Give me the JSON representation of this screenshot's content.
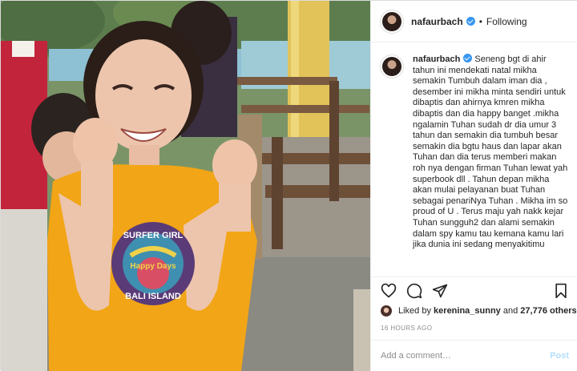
{
  "header": {
    "username": "nafaurbach",
    "separator": "•",
    "follow_status": "Following"
  },
  "caption": {
    "username": "nafaurbach",
    "text": "Seneng bgt di ahir tahun ini mendekati natal mikha semakin Tumbuh dalam iman dia , desember ini mikha minta sendiri untuk dibaptis dan ahirnya kmren mikha dibaptis dan dia happy banget .mikha ngalamin Tuhan sudah dr dia umur 3 tahun dan semakin dia tumbuh besar semakin dia bgtu haus dan lapar akan Tuhan dan dia terus memberi makan roh nya dengan firman Tuhan lewat yah superbook dll . Tahun depan mikha akan mulai pelayanan buat Tuhan sebagai penariNya Tuhan . Mikha im so proud of U . Terus maju yah nakk kejar Tuhan sungguh2 dan alami semakin dalam spy kamu tau kemana kamu lari jika dunia ini sedang menyakitimu"
  },
  "photo": {
    "shirt_text_top": "SURFER GIRL",
    "shirt_text_mid": "Happy Days",
    "shirt_text_bottom": "BALI ISLAND"
  },
  "actions": {
    "icons": [
      "heart-icon",
      "comment-icon",
      "share-icon",
      "bookmark-icon"
    ]
  },
  "likes": {
    "prefix": "Liked by",
    "user": "kerenina_sunny",
    "conjunction": "and",
    "others": "27,776 others"
  },
  "timestamp": "16 HOURS AGO",
  "comment": {
    "placeholder": "Add a comment…",
    "post_label": "Post"
  },
  "colors": {
    "shirt": "#f2a516",
    "verified": "#3897f0",
    "post_disabled": "#b2dffc"
  }
}
